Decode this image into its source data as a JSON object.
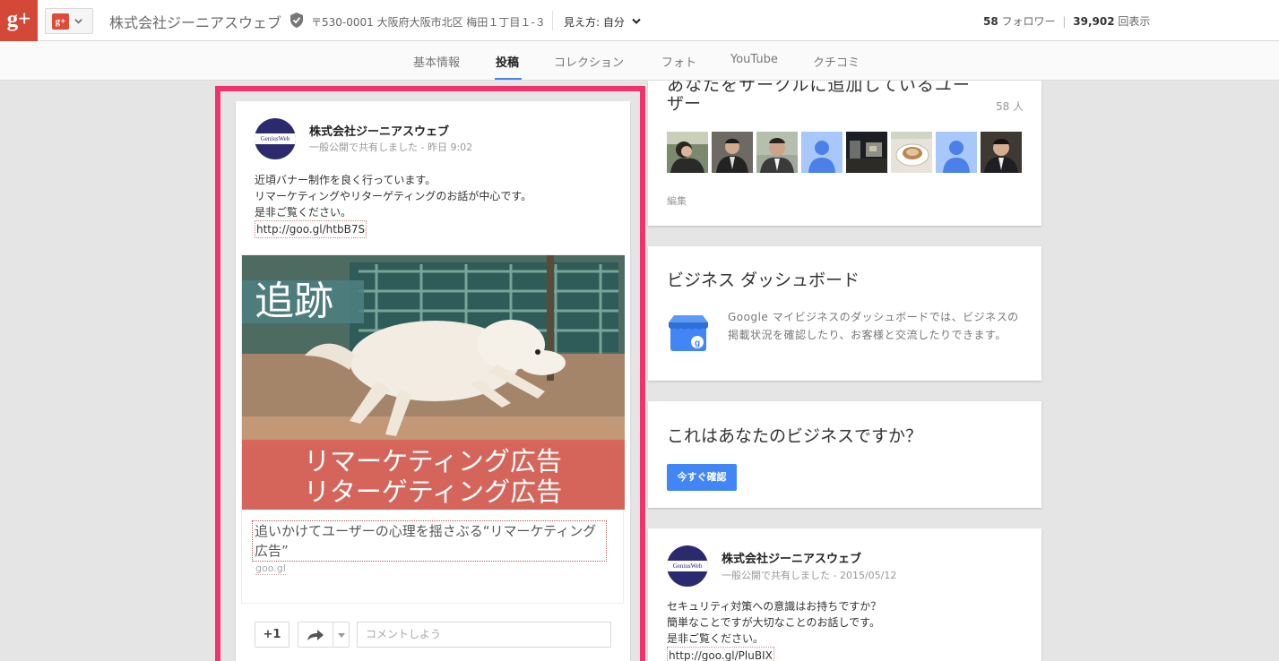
{
  "header": {
    "logo_glyph": "g+",
    "account_glyph": "g+",
    "business_name": "株式会社ジーニアスウェブ",
    "address": "〒530-0001 大阪府大阪市北区 梅田１丁目１-３",
    "view_as_label": "見え方:",
    "view_as_value": "自分",
    "followers_count": "58",
    "followers_label": "フォロワー",
    "views_count": "39,902",
    "views_label": "回表示"
  },
  "tabs": [
    {
      "label": "基本情報",
      "active": false
    },
    {
      "label": "投稿",
      "active": true
    },
    {
      "label": "コレクション",
      "active": false
    },
    {
      "label": "フォト",
      "active": false
    },
    {
      "label": "YouTube",
      "active": false
    },
    {
      "label": "クチコミ",
      "active": false
    }
  ],
  "post": {
    "author": "株式会社ジーニアスウェブ",
    "avatar_text": "GeniusWeb",
    "meta": "一般公開で共有しました  -  昨日 9:02",
    "body_lines": [
      "近頃バナー制作を良く行っています。",
      "リマーケティングやリターゲティングのお話が中心です。",
      "是非ご覧ください。"
    ],
    "link": "http://goo.gl/htbB7S",
    "banner": {
      "heading": "追跡",
      "line1": "リマーケティング広告",
      "line2": "リターゲティング広告"
    },
    "attachment_title": "追いかけてユーザーの心理を揺さぶる“リマーケティング広告”",
    "attachment_source": "goo.gl",
    "plus_one_label": "+1",
    "comment_placeholder": "コメントしよう"
  },
  "followers_card": {
    "partial_title": "あなたをサークルに追加しているユー",
    "title": "ザー",
    "count_label": "58 人",
    "edit_label": "編集"
  },
  "dashboard_card": {
    "title": "ビジネス ダッシュボード",
    "description": "Google マイビジネスのダッシュボードでは、ビジネスの掲載状況を確認したり、お客様と交流したりできます。"
  },
  "claim_card": {
    "title": "これはあなたのビジネスですか？",
    "button_label": "今すぐ確認"
  },
  "post2": {
    "author": "株式会社ジーニアスウェブ",
    "avatar_text": "GeniusWeb",
    "meta": "一般公開で共有しました  -  2015/05/12",
    "body_lines": [
      "セキュリティ対策への意識はお持ちですか？",
      "簡単なことですが大切なことのお話しです。",
      "是非ご覧ください。"
    ],
    "link": "http://goo.gl/PluBIX"
  },
  "colors": {
    "gplus_red": "#d34836",
    "highlight": "#f0336f",
    "accent_blue": "#4285f4",
    "banner_red": "#d9645a"
  }
}
